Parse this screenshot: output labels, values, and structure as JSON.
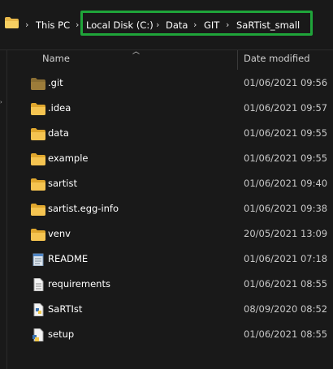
{
  "addressbar": {
    "crumbs": [
      "This PC",
      "Local Disk (C:)",
      "Data",
      "GIT",
      "SaRTist_small"
    ],
    "highlight_color": "#1fa53a"
  },
  "columns": {
    "name": "Name",
    "date": "Date modified"
  },
  "files": [
    {
      "name": ".git",
      "date": "01/06/2021 09:56",
      "icon": "folder-dim-icon"
    },
    {
      "name": ".idea",
      "date": "01/06/2021 09:57",
      "icon": "folder-icon"
    },
    {
      "name": "data",
      "date": "01/06/2021 09:55",
      "icon": "folder-icon"
    },
    {
      "name": "example",
      "date": "01/06/2021 09:55",
      "icon": "folder-icon"
    },
    {
      "name": "sartist",
      "date": "01/06/2021 09:40",
      "icon": "folder-icon"
    },
    {
      "name": "sartist.egg-info",
      "date": "01/06/2021 09:38",
      "icon": "folder-icon"
    },
    {
      "name": "venv",
      "date": "20/05/2021 13:09",
      "icon": "folder-icon"
    },
    {
      "name": "README",
      "date": "01/06/2021 07:18",
      "icon": "notepad-file-icon"
    },
    {
      "name": "requirements",
      "date": "01/06/2021 08:55",
      "icon": "text-file-icon"
    },
    {
      "name": "SaRTIst",
      "date": "08/09/2020 08:52",
      "icon": "python-file-icon"
    },
    {
      "name": "setup",
      "date": "01/06/2021 08:55",
      "icon": "python-script-icon"
    }
  ]
}
